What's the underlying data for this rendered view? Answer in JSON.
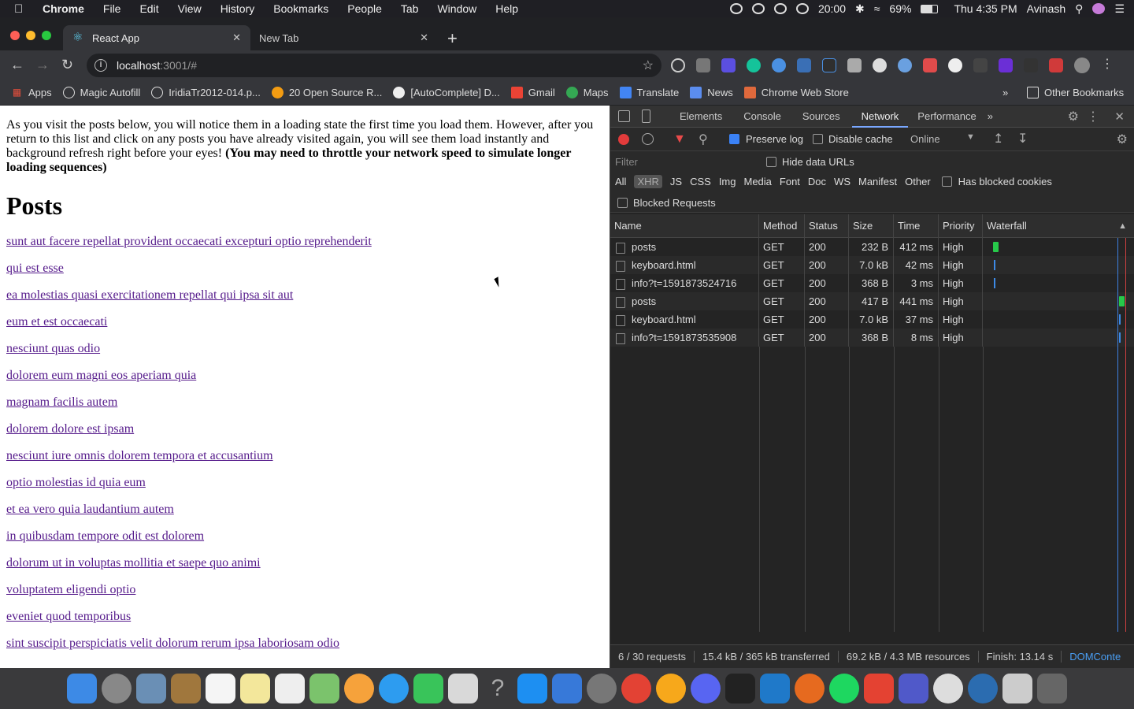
{
  "menubar": {
    "app": "Chrome",
    "items": [
      "File",
      "Edit",
      "View",
      "History",
      "Bookmarks",
      "People",
      "Tab",
      "Window",
      "Help"
    ],
    "status": {
      "timer": "20:00",
      "battery": "69%",
      "clock": "Thu 4:35 PM",
      "user": "Avinash"
    }
  },
  "tabs": [
    {
      "title": "React App"
    },
    {
      "title": "New Tab"
    }
  ],
  "address": {
    "host": "localhost",
    "path": ":3001/#"
  },
  "bookmarks": [
    "Apps",
    "Magic Autofill",
    "IridiaTr2012-014.p...",
    "20 Open Source R...",
    "[AutoComplete] D...",
    "Gmail",
    "Maps",
    "Translate",
    "News",
    "Chrome Web Store"
  ],
  "bookmarks_other": "Other Bookmarks",
  "page": {
    "intro": "As you visit the posts below, you will notice them in a loading state the first time you load them. However, after you return to this list and click on any posts you have already visited again, you will see them load instantly and background refresh right before your eyes! ",
    "intro_bold": "(You may need to throttle your network speed to simulate longer loading sequences)",
    "heading": "Posts",
    "links": [
      "sunt aut facere repellat provident occaecati excepturi optio reprehenderit",
      "qui est esse",
      "ea molestias quasi exercitationem repellat qui ipsa sit aut",
      "eum et est occaecati",
      "nesciunt quas odio",
      "dolorem eum magni eos aperiam quia",
      "magnam facilis autem",
      "dolorem dolore est ipsam",
      "nesciunt iure omnis dolorem tempora et accusantium",
      "optio molestias id quia eum",
      "et ea vero quia laudantium autem",
      "in quibusdam tempore odit est dolorem",
      "dolorum ut in voluptas mollitia et saepe quo animi",
      "voluptatem eligendi optio",
      "eveniet quod temporibus",
      "sint suscipit perspiciatis velit dolorum rerum ipsa laboriosam odio"
    ]
  },
  "devtools": {
    "tabs": [
      "Elements",
      "Console",
      "Sources",
      "Network",
      "Performance"
    ],
    "more": "»",
    "preserve_log": "Preserve log",
    "disable_cache": "Disable cache",
    "throttle": "Online",
    "filter_placeholder": "Filter",
    "hide_data_urls": "Hide data URLs",
    "types": [
      "All",
      "XHR",
      "JS",
      "CSS",
      "Img",
      "Media",
      "Font",
      "Doc",
      "WS",
      "Manifest",
      "Other"
    ],
    "has_blocked_cookies": "Has blocked cookies",
    "blocked_requests": "Blocked Requests",
    "columns": [
      "Name",
      "Method",
      "Status",
      "Size",
      "Time",
      "Priority",
      "Waterfall"
    ],
    "rows": [
      {
        "name": "posts",
        "method": "GET",
        "status": "200",
        "size": "232 B",
        "time": "412 ms",
        "priority": "High"
      },
      {
        "name": "keyboard.html",
        "method": "GET",
        "status": "200",
        "size": "7.0 kB",
        "time": "42 ms",
        "priority": "High"
      },
      {
        "name": "info?t=1591873524716",
        "method": "GET",
        "status": "200",
        "size": "368 B",
        "time": "3 ms",
        "priority": "High"
      },
      {
        "name": "posts",
        "method": "GET",
        "status": "200",
        "size": "417 B",
        "time": "441 ms",
        "priority": "High"
      },
      {
        "name": "keyboard.html",
        "method": "GET",
        "status": "200",
        "size": "7.0 kB",
        "time": "37 ms",
        "priority": "High"
      },
      {
        "name": "info?t=1591873535908",
        "method": "GET",
        "status": "200",
        "size": "368 B",
        "time": "8 ms",
        "priority": "High"
      }
    ],
    "status": {
      "requests": "6 / 30 requests",
      "transferred": "15.4 kB / 365 kB transferred",
      "resources": "69.2 kB / 4.3 MB resources",
      "finish": "Finish: 13.14 s",
      "dom": "DOMConte"
    }
  }
}
